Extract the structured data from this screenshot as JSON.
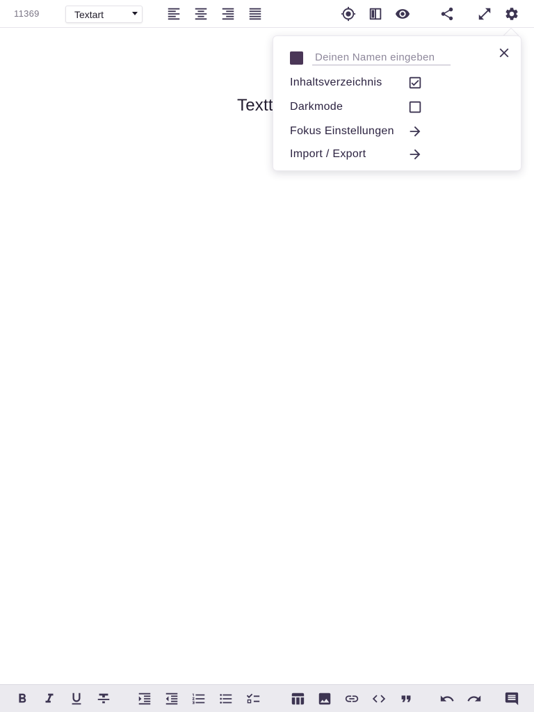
{
  "topbar": {
    "word_count": "11369",
    "textart": {
      "label": "Textart"
    },
    "icons": {
      "align_left": "align-left-icon",
      "align_center": "align-center-icon",
      "align_right": "align-right-icon",
      "align_justify": "align-justify-icon",
      "focus": "crosshair-icon",
      "split_view": "split-view-icon",
      "preview": "eye-icon",
      "share": "share-icon",
      "fullscreen": "fullscreen-icon",
      "settings": "gear-icon"
    }
  },
  "document": {
    "title_visible": "Textt"
  },
  "settings_popup": {
    "user_color": "#4a3657",
    "name_placeholder": "Deinen Namen eingeben",
    "name_value": "",
    "rows": [
      {
        "label": "Inhaltsverzeichnis",
        "control": "checkbox",
        "checked": true
      },
      {
        "label": "Darkmode",
        "control": "checkbox",
        "checked": false
      },
      {
        "label": "Fokus Einstellungen",
        "control": "arrow"
      },
      {
        "label": "Import / Export",
        "control": "arrow"
      }
    ]
  },
  "bottombar": {
    "icons": [
      "bold-icon",
      "italic-icon",
      "underline-icon",
      "strikethrough-icon",
      "indent-increase-icon",
      "indent-decrease-icon",
      "numbered-list-icon",
      "bullet-list-icon",
      "checklist-icon",
      "table-icon",
      "image-icon",
      "link-icon",
      "code-icon",
      "quote-icon",
      "undo-icon",
      "redo-icon",
      "comment-icon"
    ]
  },
  "colors": {
    "icon": "#3d3552",
    "text": "#2b2240",
    "bottombar_bg": "#ebeaef"
  }
}
